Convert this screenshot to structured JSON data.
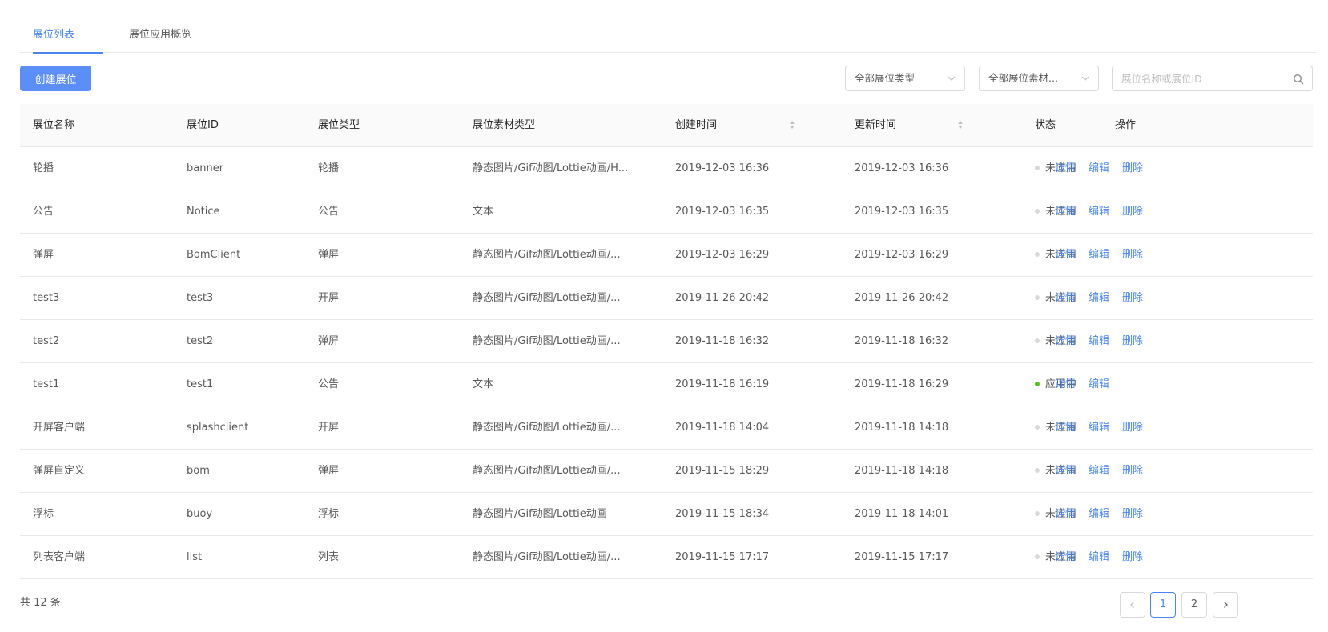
{
  "tabs": [
    {
      "label": "展位列表",
      "active": true
    },
    {
      "label": "展位应用概览",
      "active": false
    }
  ],
  "toolbar": {
    "create_label": "创建展位",
    "type_select": "全部展位类型",
    "material_select": "全部展位素材...",
    "search_placeholder": "展位名称或展位ID"
  },
  "table": {
    "headers": {
      "name": "展位名称",
      "id": "展位ID",
      "type": "展位类型",
      "material": "展位素材类型",
      "created": "创建时间",
      "updated": "更新时间",
      "status": "状态",
      "ops": "操作"
    },
    "actions": {
      "detail": "详情",
      "edit": "编辑",
      "delete": "删除"
    },
    "rows": [
      {
        "name": "轮播",
        "id": "banner",
        "type": "轮播",
        "material": "静态图片/Gif动图/Lottie动画/H...",
        "created": "2019-12-03 16:36",
        "updated": "2019-12-03 16:36",
        "status": "未应用",
        "applied": false
      },
      {
        "name": "公告",
        "id": "Notice",
        "type": "公告",
        "material": "文本",
        "created": "2019-12-03 16:35",
        "updated": "2019-12-03 16:35",
        "status": "未应用",
        "applied": false
      },
      {
        "name": "弹屏",
        "id": "BomClient",
        "type": "弹屏",
        "material": "静态图片/Gif动图/Lottie动画/...",
        "created": "2019-12-03 16:29",
        "updated": "2019-12-03 16:29",
        "status": "未应用",
        "applied": false
      },
      {
        "name": "test3",
        "id": "test3",
        "type": "开屏",
        "material": "静态图片/Gif动图/Lottie动画/...",
        "created": "2019-11-26 20:42",
        "updated": "2019-11-26 20:42",
        "status": "未应用",
        "applied": false
      },
      {
        "name": "test2",
        "id": "test2",
        "type": "弹屏",
        "material": "静态图片/Gif动图/Lottie动画/...",
        "created": "2019-11-18 16:32",
        "updated": "2019-11-18 16:32",
        "status": "未应用",
        "applied": false
      },
      {
        "name": "test1",
        "id": "test1",
        "type": "公告",
        "material": "文本",
        "created": "2019-11-18 16:19",
        "updated": "2019-11-18 16:29",
        "status": "应用中",
        "applied": true
      },
      {
        "name": "开屏客户端",
        "id": "splashclient",
        "type": "开屏",
        "material": "静态图片/Gif动图/Lottie动画/...",
        "created": "2019-11-18 14:04",
        "updated": "2019-11-18 14:18",
        "status": "未应用",
        "applied": false
      },
      {
        "name": "弹屏自定义",
        "id": "bom",
        "type": "弹屏",
        "material": "静态图片/Gif动图/Lottie动画/...",
        "created": "2019-11-15 18:29",
        "updated": "2019-11-18 14:18",
        "status": "未应用",
        "applied": false
      },
      {
        "name": "浮标",
        "id": "buoy",
        "type": "浮标",
        "material": "静态图片/Gif动图/Lottie动画",
        "created": "2019-11-15 18:34",
        "updated": "2019-11-18 14:01",
        "status": "未应用",
        "applied": false
      },
      {
        "name": "列表客户端",
        "id": "list",
        "type": "列表",
        "material": "静态图片/Gif动图/Lottie动画/...",
        "created": "2019-11-15 17:17",
        "updated": "2019-11-15 17:17",
        "status": "未应用",
        "applied": false
      }
    ]
  },
  "footer": {
    "total": "共 12 条",
    "pages": [
      "1",
      "2"
    ],
    "current_page": "1"
  },
  "colors": {
    "accent": "#4a86f0",
    "button": "#5b8ff7",
    "active_status": "#52c41a",
    "inactive_status": "#d9d9d9"
  },
  "icons": {
    "select_arrow": "chevron-down-icon",
    "search": "search-icon",
    "sort": "sort-icon",
    "prev": "chevron-left-icon",
    "next": "chevron-right-icon"
  }
}
